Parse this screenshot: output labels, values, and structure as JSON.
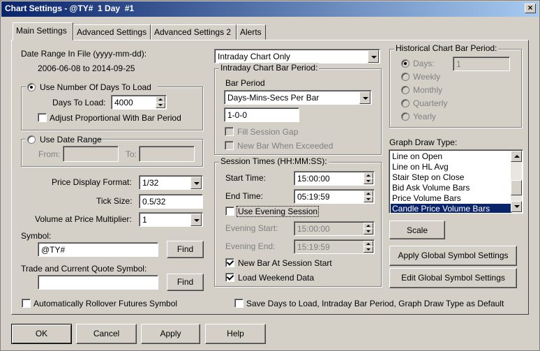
{
  "window": {
    "title": "Chart Settings - @TY#  1 Day  #1",
    "close_glyph": "×"
  },
  "tabs": [
    "Main Settings",
    "Advanced Settings",
    "Advanced Settings 2",
    "Alerts"
  ],
  "date_range": {
    "label": "Date Range In File (yyyy-mm-dd):",
    "value": "2006-06-08 to 2014-09-25"
  },
  "days_group": {
    "radio_label": "Use Number Of Days To Load",
    "days_label": "Days To Load:",
    "days_value": "4000",
    "adjust_label": "Adjust Proportional With Bar Period"
  },
  "date_range_group": {
    "radio_label": "Use Date Range",
    "from_label": "From:",
    "to_label": "To:"
  },
  "price_display": {
    "label": "Price Display Format:",
    "value": "1/32"
  },
  "tick_size": {
    "label": "Tick Size:",
    "value": "0.5/32"
  },
  "volume_multiplier": {
    "label": "Volume at Price Multiplier:",
    "value": "1"
  },
  "symbol": {
    "label": "Symbol:",
    "value": "@TY#",
    "find_label": "Find"
  },
  "quote_symbol": {
    "label": "Trade and Current Quote Symbol:",
    "value": "",
    "find_label": "Find"
  },
  "auto_rollover": {
    "label": "Automatically Rollover Futures Symbol"
  },
  "chart_mode": {
    "value": "Intraday Chart Only"
  },
  "intraday_group": {
    "title": "Intraday Chart Bar Period:",
    "bar_period_label": "Bar Period",
    "bar_period_value": "Days-Mins-Secs Per Bar",
    "period_value": "1-0-0",
    "fill_gap_label": "Fill Session Gap",
    "new_bar_exceeded_label": "New Bar When Exceeded"
  },
  "session_group": {
    "title": "Session Times (HH:MM:SS):",
    "start_label": "Start Time:",
    "start_value": "15:00:00",
    "end_label": "End Time:",
    "end_value": "05:19:59",
    "evening_label": "Use Evening Session",
    "evening_start_label": "Evening Start:",
    "evening_start_value": "15:00:00",
    "evening_end_label": "Evening End:",
    "evening_end_value": "15:19:59",
    "new_bar_label": "New Bar At Session Start",
    "weekend_label": "Load Weekend Data"
  },
  "historical_group": {
    "title": "Historical Chart Bar Period:",
    "options": [
      "Days:",
      "Weekly",
      "Monthly",
      "Quarterly",
      "Yearly"
    ],
    "days_value": "1"
  },
  "graph_draw": {
    "label": "Graph Draw Type:",
    "items": [
      "Line on Open",
      "Line on HL Avg",
      "Stair Step on Close",
      "Bid Ask Volume Bars",
      "Price Volume Bars",
      "Candle Price Volume Bars"
    ],
    "selected": "Candle Price Volume Bars"
  },
  "scale_label": "Scale",
  "apply_global_label": "Apply Global Symbol Settings",
  "edit_global_label": "Edit Global Symbol Settings",
  "save_default_label": "Save Days to Load, Intraday Bar Period, Graph Draw Type as Default",
  "footer": {
    "ok": "OK",
    "cancel": "Cancel",
    "apply": "Apply",
    "help": "Help"
  },
  "colors": {
    "title_bar": "#0a246a",
    "face": "#d4d0c8",
    "selection": "#0a246a"
  }
}
